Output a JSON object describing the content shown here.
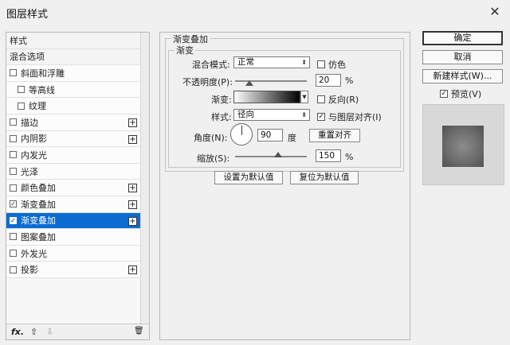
{
  "window": {
    "title": "图层样式",
    "close_glyph": "✕"
  },
  "left_panel": {
    "items": [
      {
        "label": "样式",
        "checkbox": false,
        "checked": false,
        "plus": false,
        "selected": false,
        "indent": false
      },
      {
        "label": "混合选项",
        "checkbox": false,
        "checked": false,
        "plus": false,
        "selected": false,
        "indent": false
      },
      {
        "label": "斜面和浮雕",
        "checkbox": true,
        "checked": false,
        "plus": false,
        "selected": false,
        "indent": false
      },
      {
        "label": "等高线",
        "checkbox": true,
        "checked": false,
        "plus": false,
        "selected": false,
        "indent": true
      },
      {
        "label": "纹理",
        "checkbox": true,
        "checked": false,
        "plus": false,
        "selected": false,
        "indent": true
      },
      {
        "label": "描边",
        "checkbox": true,
        "checked": false,
        "plus": true,
        "selected": false,
        "indent": false
      },
      {
        "label": "内阴影",
        "checkbox": true,
        "checked": false,
        "plus": true,
        "selected": false,
        "indent": false
      },
      {
        "label": "内发光",
        "checkbox": true,
        "checked": false,
        "plus": false,
        "selected": false,
        "indent": false
      },
      {
        "label": "光泽",
        "checkbox": true,
        "checked": false,
        "plus": false,
        "selected": false,
        "indent": false
      },
      {
        "label": "颜色叠加",
        "checkbox": true,
        "checked": false,
        "plus": true,
        "selected": false,
        "indent": false
      },
      {
        "label": "渐变叠加",
        "checkbox": true,
        "checked": true,
        "plus": true,
        "selected": false,
        "indent": false
      },
      {
        "label": "渐变叠加",
        "checkbox": true,
        "checked": true,
        "plus": true,
        "selected": true,
        "indent": false
      },
      {
        "label": "图案叠加",
        "checkbox": true,
        "checked": false,
        "plus": false,
        "selected": false,
        "indent": false
      },
      {
        "label": "外发光",
        "checkbox": true,
        "checked": false,
        "plus": false,
        "selected": false,
        "indent": false
      },
      {
        "label": "投影",
        "checkbox": true,
        "checked": false,
        "plus": true,
        "selected": false,
        "indent": false
      }
    ],
    "bottom": {
      "fx": "fx.",
      "up": "⇧",
      "down": "⇩",
      "trash": "🗑"
    },
    "selected_color": "#0a6cd1"
  },
  "gradient_overlay": {
    "group_title": "渐变叠加",
    "sub_title": "渐变",
    "blend_mode_label": "混合模式:",
    "blend_mode_value": "正常",
    "dither_label": "仿色",
    "opacity_label": "不透明度(P):",
    "opacity_value": "20",
    "opacity_unit": "%",
    "opacity_level": 0.2,
    "gradient_label": "渐变:",
    "reverse_label": "反向(R)",
    "style_label": "样式:",
    "style_value": "径向",
    "align_label": "与图层对齐(I)",
    "angle_label": "角度(N):",
    "angle_value": "90",
    "angle_unit": "度",
    "reset_align_button": "重置对齐",
    "scale_label": "缩放(S):",
    "scale_value": "150",
    "scale_unit": "%",
    "scale_level": 0.6,
    "set_default_button": "设置为默认值",
    "reset_default_button": "复位为默认值",
    "select_arrow": "⬍",
    "check_mark": "✓"
  },
  "right_panel": {
    "ok_button": "确定",
    "cancel_button": "取消",
    "new_style_button": "新建样式(W)...",
    "preview_label": "预览(V)",
    "preview_checked": true
  }
}
